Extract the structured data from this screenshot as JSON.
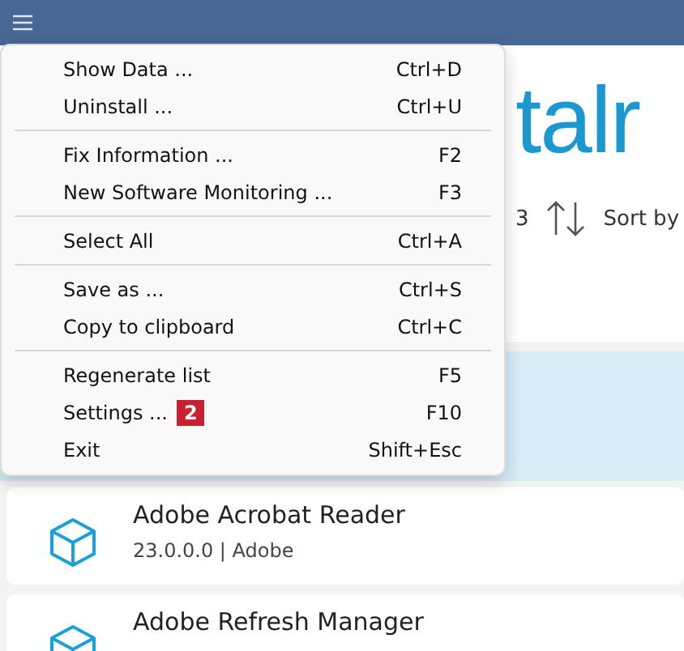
{
  "header": {
    "logo_text": "talr",
    "count": "3",
    "sort_label": "Sort by"
  },
  "list": {
    "selected_row": {
      "selected": true
    },
    "items": [
      {
        "name": "Adobe Acrobat Reader",
        "details": "23.0.0.0 | Adobe"
      },
      {
        "name": "Adobe Refresh Manager"
      }
    ]
  },
  "menu": {
    "groups": [
      [
        {
          "label": "Show Data ...",
          "shortcut": "Ctrl+D"
        },
        {
          "label": "Uninstall ...",
          "shortcut": "Ctrl+U"
        }
      ],
      [
        {
          "label": "Fix Information ...",
          "shortcut": "F2"
        },
        {
          "label": "New Software Monitoring ...",
          "shortcut": "F3"
        }
      ],
      [
        {
          "label": "Select All",
          "shortcut": "Ctrl+A"
        }
      ],
      [
        {
          "label": "Save as ...",
          "shortcut": "Ctrl+S"
        },
        {
          "label": "Copy to clipboard",
          "shortcut": "Ctrl+C"
        }
      ],
      [
        {
          "label": "Regenerate list",
          "shortcut": "F5"
        },
        {
          "label": "Settings ...",
          "shortcut": "F10",
          "badge": "2"
        },
        {
          "label": "Exit",
          "shortcut": "Shift+Esc"
        }
      ]
    ]
  }
}
